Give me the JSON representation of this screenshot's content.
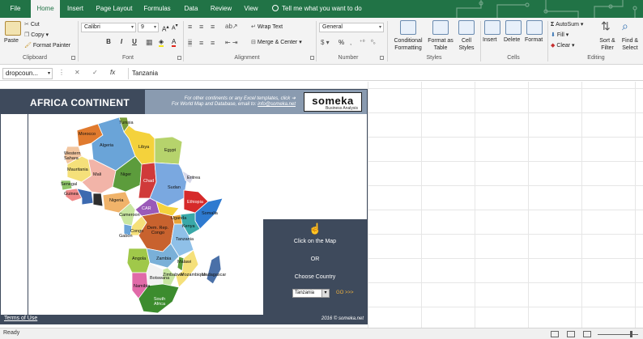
{
  "tabs": [
    "File",
    "Home",
    "Insert",
    "Page Layout",
    "Formulas",
    "Data",
    "Review",
    "View"
  ],
  "tell_me": "Tell me what you want to do",
  "ribbon": {
    "clipboard": {
      "paste": "Paste",
      "cut": "Cut",
      "copy": "Copy",
      "format_painter": "Format Painter",
      "label": "Clipboard"
    },
    "font": {
      "name": "Calibri",
      "size": "9",
      "label": "Font",
      "bold": "B",
      "italic": "I",
      "underline": "U"
    },
    "alignment": {
      "wrap": "Wrap Text",
      "merge": "Merge & Center",
      "label": "Alignment"
    },
    "number": {
      "format": "General",
      "label": "Number",
      "pct": "%"
    },
    "styles": {
      "cond": "Conditional Formatting",
      "fmt_table": "Format as Table",
      "cell_styles": "Cell Styles",
      "label": "Styles"
    },
    "cells": {
      "insert": "Insert",
      "delete": "Delete",
      "format": "Format",
      "label": "Cells"
    },
    "editing": {
      "autosum": "AutoSum",
      "fill": "Fill",
      "clear": "Clear",
      "sort": "Sort & Filter",
      "find": "Find & Select",
      "label": "Editing"
    }
  },
  "formula_bar": {
    "name_box": "dropcoun...",
    "fx": "fx",
    "value": "Tanzania"
  },
  "template": {
    "title": "AFRICA CONTINENT",
    "note1": "For other continents or any Excel templates, click ➔",
    "note2_prefix": "For World Map and Database, email to:",
    "note2_email": "info@someka.net",
    "logo": "someka",
    "logo_sub": "Business Analysis",
    "panel_click": "Click on the Map",
    "panel_or": "OR",
    "panel_choose": "Choose Country",
    "country": "Tanzania",
    "go": "GO >>>",
    "terms": "Terms of Use",
    "copyright": "2016 © someka.net"
  },
  "countries": [
    "Tunisia",
    "Morocco",
    "Algeria",
    "Libya",
    "Egypt",
    "Western Sahara",
    "Mauritania",
    "Mali",
    "Niger",
    "Chad",
    "Sudan",
    "Eritrea",
    "Senegal",
    "Guinea",
    "Nigeria",
    "Cameroon",
    "CAR",
    "Ethiopia",
    "Somalia",
    "Uganda",
    "Kenya",
    "Dem. Rep. Congo",
    "Congo",
    "Gabon",
    "Tanzania",
    "Angola",
    "Zambia",
    "Malawi",
    "Mozambique",
    "Namibia",
    "Botswana",
    "Zimbabwe",
    "South Africa",
    "Madagascar"
  ],
  "status": {
    "ready": "Ready"
  },
  "colors": {
    "accent": "#217346",
    "header": "#3e4a5c",
    "header_light": "#8a9bb0",
    "go": "#f2b33d"
  }
}
